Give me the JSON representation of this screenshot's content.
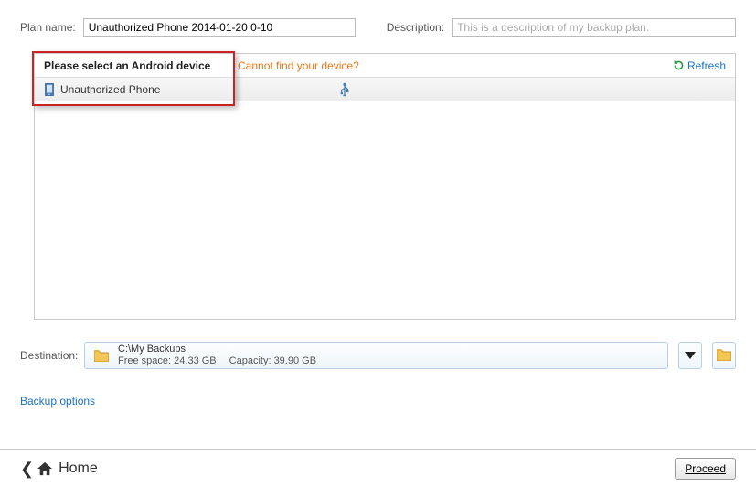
{
  "top": {
    "plan_name_label": "Plan name:",
    "plan_name_value": "Unauthorized Phone 2014-01-20 0-10",
    "description_label": "Description:",
    "description_placeholder": "This is a description of my backup plan."
  },
  "device_panel": {
    "header_prompt": "Please select an Android device",
    "cannot_find": "Cannot find your device?",
    "refresh_label": "Refresh",
    "rows": [
      {
        "name": "Unauthorized Phone",
        "connection_icon": "usb"
      }
    ]
  },
  "destination": {
    "label": "Destination:",
    "path": "C:\\My Backups",
    "free_space_label": "Free space:",
    "free_space_value": "24.33 GB",
    "capacity_label": "Capacity:",
    "capacity_value": "39.90 GB"
  },
  "links": {
    "backup_options": "Backup options"
  },
  "footer": {
    "home_label": "Home",
    "proceed_label": "Proceed"
  },
  "icons": {
    "refresh": "refresh-icon",
    "phone": "phone-icon",
    "usb": "usb-icon",
    "folder": "folder-icon",
    "dropdown": "chevron-down-icon",
    "browse": "folder-icon",
    "home": "home-icon",
    "back": "chevron-left-icon"
  }
}
